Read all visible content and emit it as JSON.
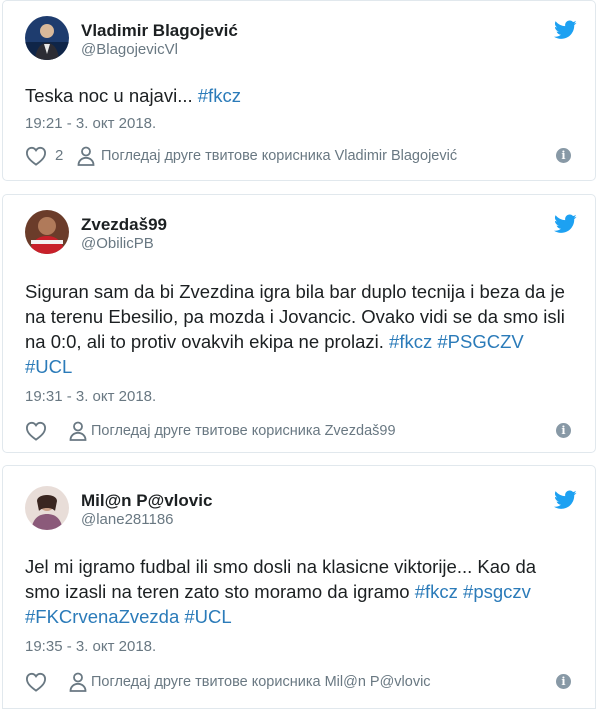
{
  "colors": {
    "link": "#2b7bb9",
    "muted": "#697882",
    "twitter_blue": "#1da1f2",
    "border": "#e1e8ed"
  },
  "tweets": [
    {
      "name": "Vladimir Blagojević",
      "handle": "@BlagojevicVl",
      "text_plain": "Teska noc u najavi... ",
      "hashtags": [
        "#fkcz"
      ],
      "timestamp": "19:21 - 3. окт 2018.",
      "likes": "2",
      "more_link": "Погледај друге твитове корисника Vladimir Blagojević",
      "icons": [
        "twitter-bird-icon",
        "heart-icon",
        "person-icon",
        "info-icon"
      ]
    },
    {
      "name": "Zvezdaš99",
      "handle": "@ObilicPB",
      "text_plain": "Siguran sam da bi Zvezdina igra bila bar duplo tecnija i beza da je na terenu Ebesilio, pa mozda i Jovancic. Ovako vidi se da smo isli na 0:0, ali to protiv ovakvih ekipa ne prolazi. ",
      "hashtags": [
        "#fkcz",
        "#PSGCZV",
        "#UCL"
      ],
      "timestamp": "19:31 - 3. окт 2018.",
      "likes": "",
      "more_link": "Погледај друге твитове корисника Zvezdaš99",
      "icons": [
        "twitter-bird-icon",
        "heart-icon",
        "person-icon",
        "info-icon"
      ]
    },
    {
      "name": "Mil@n P@vlovic",
      "handle": "@lane281186",
      "text_plain": "Jel mi igramo fudbal ili smo dosli na klasicne viktorije... Kao da smo izasli na teren zato sto moramo da igramo ",
      "hashtags": [
        "#fkcz",
        "#psgczv",
        "#FKCrvenaZvezda",
        "#UCL"
      ],
      "timestamp": "19:35 - 3. окт 2018.",
      "likes": "",
      "more_link": "Погледај друге твитове корисника Mil@n P@vlovic",
      "icons": [
        "twitter-bird-icon",
        "heart-icon",
        "person-icon",
        "info-icon"
      ]
    }
  ]
}
